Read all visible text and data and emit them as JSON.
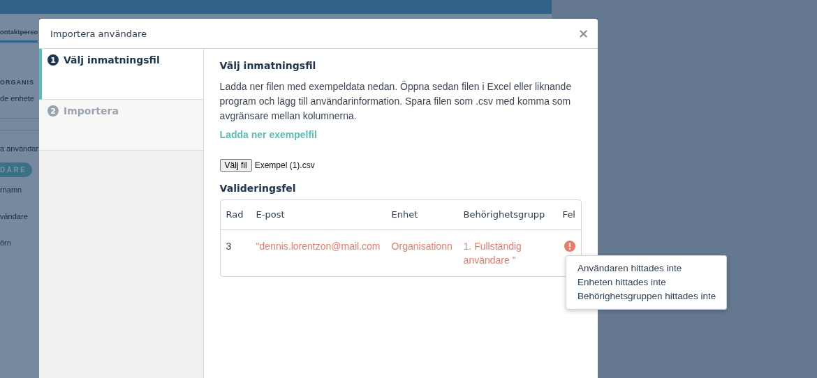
{
  "background_page": {
    "tab": "ontaktperso",
    "section_heading": "ORGANIS",
    "lines": [
      {
        "kind": "text",
        "text": "de enhete"
      },
      {
        "kind": "rule"
      },
      {
        "kind": "rule"
      },
      {
        "kind": "text",
        "text": "a användar"
      },
      {
        "kind": "button",
        "text": "DARE"
      },
      {
        "kind": "text",
        "text": "rnamn"
      },
      {
        "kind": "text",
        "text": "vändare"
      },
      {
        "kind": "text",
        "text": "örn"
      }
    ]
  },
  "dialog": {
    "title": "Importera användare",
    "steps": [
      {
        "number": "1",
        "label": "Välj inmatningsfil",
        "selected": true
      },
      {
        "number": "2",
        "label": "Importera",
        "selected": false
      }
    ],
    "heading": "Välj inmatningsfil",
    "description": "Ladda ner filen med exempeldata nedan. Öppna sedan filen i Excel eller liknande program och lägg till användarinformation. Spara filen som .csv med komma som avgränsare mellan kolumnerna.",
    "download_link": "Ladda ner exempelfil",
    "file_input": {
      "button": "Välj fil",
      "value": "Exempel (1).csv"
    },
    "errors_heading": "Valideringsfel",
    "table": {
      "columns": [
        "Rad",
        "E-post",
        "Enhet",
        "Behörighetsgrupp",
        "Fel"
      ],
      "rows": [
        {
          "row": "3",
          "email": "\"dennis.lorentzon@mail.com",
          "unit": "Organisationn",
          "group": "1. Fullständig användare \"",
          "error": true
        }
      ]
    },
    "tooltip": [
      "Användaren hittades inte",
      "Enheten hittades inte",
      "Behörighetsgruppen hittades inte"
    ]
  }
}
